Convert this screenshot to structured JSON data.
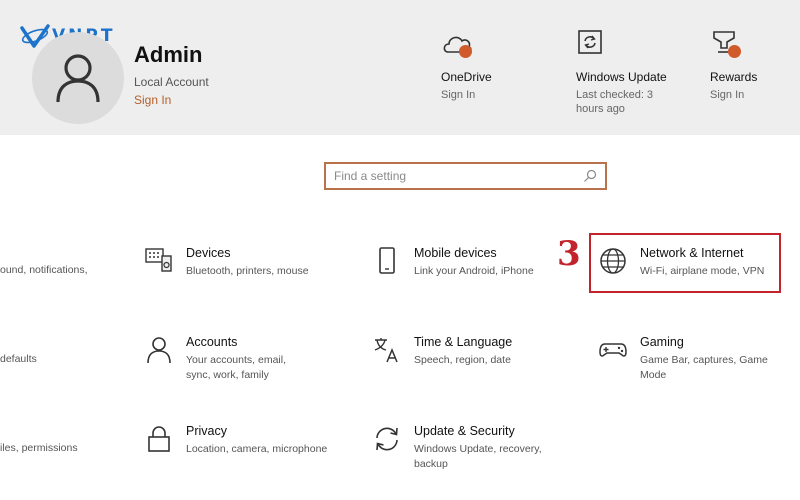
{
  "logo": {
    "text": "VNPT"
  },
  "account": {
    "name": "Admin",
    "type": "Local Account",
    "sign_in": "Sign In"
  },
  "header_items": [
    {
      "title": "OneDrive",
      "sub": "Sign In",
      "icon": "cloud-icon"
    },
    {
      "title": "Windows Update",
      "sub": "Last checked: 3 hours ago",
      "icon": "update-icon"
    },
    {
      "title": "Rewards",
      "sub": "Sign In",
      "icon": "trophy-icon"
    }
  ],
  "search": {
    "placeholder": "Find a setting"
  },
  "partial_texts": [
    "ound, notifications,",
    "defaults",
    "iles, permissions"
  ],
  "tiles": [
    {
      "title": "Devices",
      "desc": "Bluetooth, printers, mouse",
      "icon": "devices-icon"
    },
    {
      "title": "Mobile devices",
      "desc": "Link your Android, iPhone",
      "icon": "phone-icon"
    },
    {
      "title": "Network & Internet",
      "desc": "Wi-Fi, airplane mode, VPN",
      "icon": "globe-icon"
    },
    {
      "title": "Accounts",
      "desc": "Your accounts, email, sync, work, family",
      "icon": "person-icon"
    },
    {
      "title": "Time & Language",
      "desc": "Speech, region, date",
      "icon": "language-icon"
    },
    {
      "title": "Gaming",
      "desc": "Game Bar, captures, Game Mode",
      "icon": "gamepad-icon"
    },
    {
      "title": "Privacy",
      "desc": "Location, camera, microphone",
      "icon": "lock-icon"
    },
    {
      "title": "Update & Security",
      "desc": "Windows Update, recovery, backup",
      "icon": "sync-icon"
    }
  ],
  "annotation": {
    "step": "3"
  },
  "colors": {
    "accent": "#b5602b",
    "highlight": "#c3242b",
    "brand": "#1d73c9",
    "badge": "#d05a2a"
  }
}
